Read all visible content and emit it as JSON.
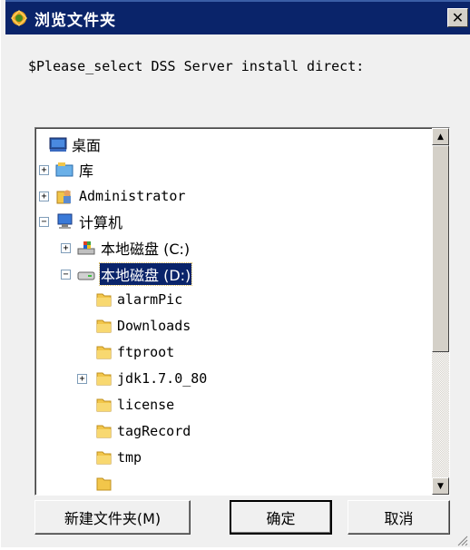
{
  "window": {
    "title": "浏览文件夹",
    "close_label": "✕",
    "prompt": "$Please_select DSS Server install direct:"
  },
  "tree": {
    "items": [
      {
        "label": "桌面",
        "icon": "desktop-icon",
        "expander": ""
      },
      {
        "label": "库",
        "icon": "library-icon",
        "expander": "+"
      },
      {
        "label": "Administrator",
        "icon": "user-folder-icon",
        "expander": "+"
      },
      {
        "label": "计算机",
        "icon": "computer-icon",
        "expander": "−"
      },
      {
        "label": "本地磁盘 (C:)",
        "icon": "system-drive-icon",
        "expander": "+"
      },
      {
        "label": "本地磁盘 (D:)",
        "icon": "drive-icon",
        "expander": "−",
        "selected": true
      },
      {
        "label": "alarmPic",
        "icon": "folder-icon",
        "expander": ""
      },
      {
        "label": "Downloads",
        "icon": "folder-icon",
        "expander": ""
      },
      {
        "label": "ftproot",
        "icon": "folder-icon",
        "expander": ""
      },
      {
        "label": "jdk1.7.0_80",
        "icon": "folder-icon",
        "expander": "+"
      },
      {
        "label": "license",
        "icon": "folder-icon",
        "expander": ""
      },
      {
        "label": "tagRecord",
        "icon": "folder-icon",
        "expander": ""
      },
      {
        "label": "tmp",
        "icon": "folder-icon",
        "expander": ""
      }
    ]
  },
  "buttons": {
    "new_folder": "新建文件夹(M)",
    "ok": "确定",
    "cancel": "取消"
  },
  "colors": {
    "title_bar": "#0a246a",
    "selection": "#0a246a",
    "folder": "#f2c64a"
  }
}
